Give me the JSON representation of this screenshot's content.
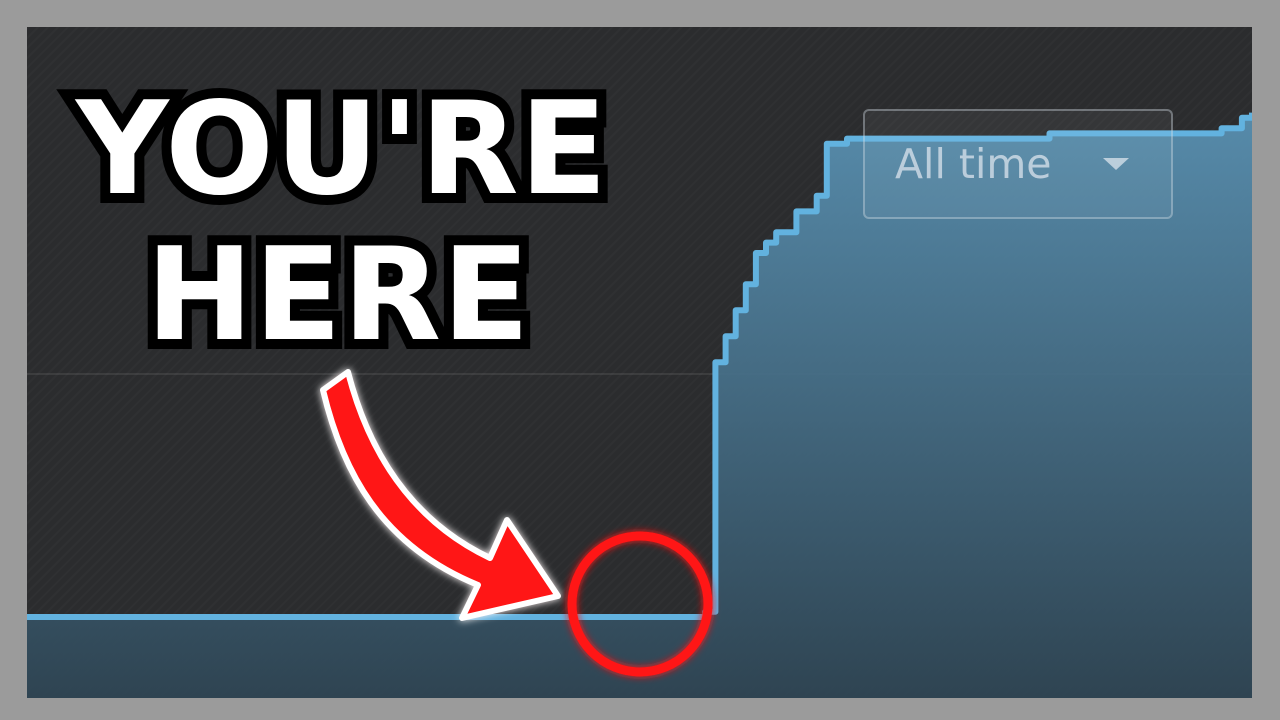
{
  "thumbnail": {
    "headline_line1": "YOU'RE",
    "headline_line2": "HERE"
  },
  "dropdown": {
    "selected": "All time",
    "icon": "caret-down-icon"
  },
  "colors": {
    "background": "#2b2c2e",
    "frame": "#9b9b9b",
    "line": "#62b2df",
    "fill_top": "#5a93b5",
    "fill_bottom": "#2f4655",
    "marker": "#ff1414",
    "text": "#ffffff"
  },
  "chart_data": {
    "type": "area",
    "title": "",
    "xlabel": "",
    "ylabel": "",
    "grid": true,
    "series": [
      {
        "values": [
          0.0,
          0.0,
          0.0,
          0.0,
          0.0,
          0.0,
          0.0,
          0.0,
          0.0,
          0.0,
          0.0,
          0.0,
          0.0,
          0.0,
          0.0,
          0.0,
          0.0,
          0.0,
          0.0,
          0.0,
          0.0,
          0.0,
          0.0,
          0.0,
          0.0,
          0.0,
          0.0,
          0.0,
          0.0,
          0.0,
          0.0,
          0.0,
          0.0,
          0.0,
          0.0,
          0.0,
          0.0,
          0.0,
          0.0,
          0.0,
          0.0,
          0.0,
          0.0,
          0.0,
          0.0,
          0.0,
          0.0,
          0.0,
          0.0,
          0.0,
          0.0,
          0.0,
          0.0,
          0.0,
          0.0,
          0.0,
          0.0,
          0.0,
          0.0,
          0.0,
          0.0,
          0.0,
          0.0,
          0.0,
          0.0,
          0.0,
          0.0,
          0.01,
          0.49,
          0.54,
          0.59,
          0.64,
          0.7,
          0.72,
          0.74,
          0.74,
          0.78,
          0.78,
          0.81,
          0.91,
          0.91,
          0.92,
          0.92,
          0.92,
          0.92,
          0.92,
          0.92,
          0.92,
          0.92,
          0.92,
          0.92,
          0.92,
          0.92,
          0.92,
          0.92,
          0.92,
          0.92,
          0.92,
          0.92,
          0.92,
          0.92,
          0.93,
          0.93,
          0.93,
          0.93,
          0.93,
          0.93,
          0.93,
          0.93,
          0.93,
          0.93,
          0.93,
          0.93,
          0.93,
          0.93,
          0.93,
          0.93,
          0.93,
          0.94,
          0.94,
          0.96,
          0.97
        ]
      }
    ],
    "highlight_index": 66
  }
}
